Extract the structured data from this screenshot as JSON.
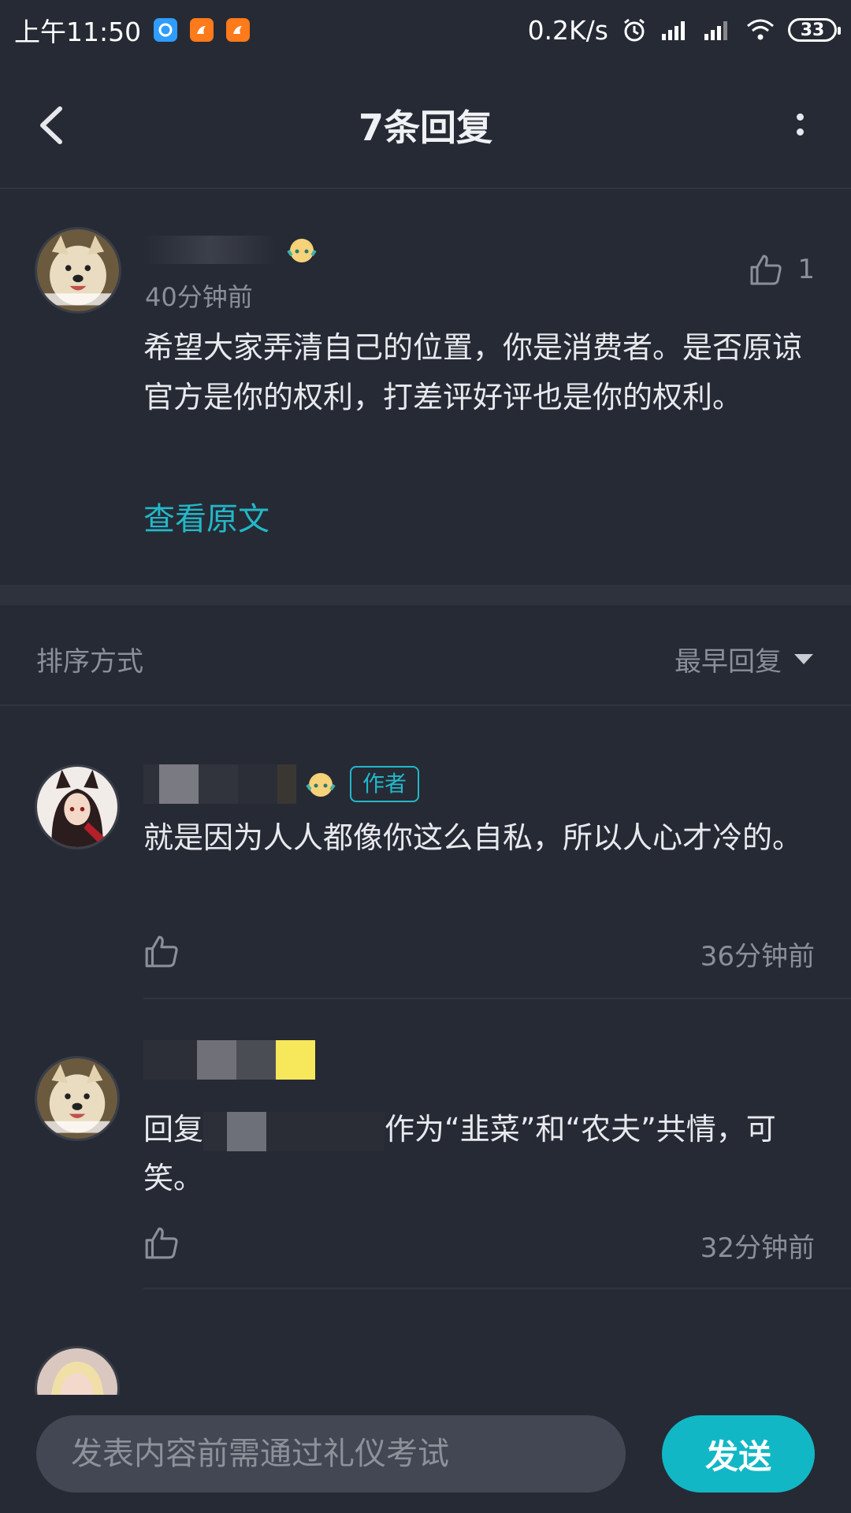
{
  "status_bar": {
    "time": "上午11:50",
    "net_speed": "0.2K/s",
    "battery": "33"
  },
  "nav": {
    "title": "7条回复"
  },
  "original_comment": {
    "time": "40分钟前",
    "like_count": "1",
    "text": "希望大家弄清自己的位置，你是消费者。是否原谅官方是你的权利，打差评好评也是你的权利。",
    "view_original": "查看原文"
  },
  "sort": {
    "label": "排序方式",
    "selected": "最早回复"
  },
  "replies": [
    {
      "author_tag": "作者",
      "text": "就是因为人人都像你这么自私，所以人心才冷的。",
      "time": "36分钟前"
    },
    {
      "text_prefix": "回复",
      "text_suffix": "作为“韭菜”和“农夫”共情，可笑。",
      "time": "32分钟前"
    }
  ],
  "composer": {
    "placeholder": "发表内容前需通过礼仪考试",
    "send_label": "发送"
  }
}
